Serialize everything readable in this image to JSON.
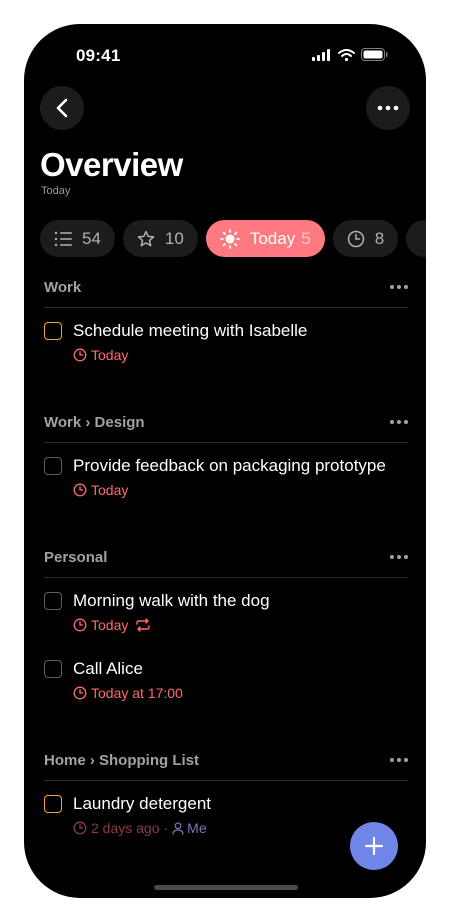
{
  "status": {
    "time": "09:41"
  },
  "header": {
    "title": "Overview",
    "subtitle": "Today"
  },
  "filters": [
    {
      "icon": "list-icon",
      "count": "54",
      "label": ""
    },
    {
      "icon": "star-icon",
      "count": "10",
      "label": ""
    },
    {
      "icon": "sun-icon",
      "count": "5",
      "label": "Today",
      "active": true
    },
    {
      "icon": "clock-icon",
      "count": "8",
      "label": ""
    }
  ],
  "sections": [
    {
      "name": "Work",
      "tasks": [
        {
          "title": "Schedule meeting with Isabelle",
          "due": "Today"
        }
      ]
    },
    {
      "name": "Work › Design",
      "tasks": [
        {
          "title": "Provide feedback on packaging prototype",
          "due": "Today"
        }
      ]
    },
    {
      "name": "Personal",
      "tasks": [
        {
          "title": "Morning walk with the dog",
          "due": "Today",
          "repeat": true
        },
        {
          "title": "Call Alice",
          "due": "Today at 17:00"
        }
      ]
    },
    {
      "name": "Home › Shopping List",
      "tasks": [
        {
          "title": "Laundry detergent",
          "due": "2 days ago",
          "sep": "·",
          "assignee": "Me"
        }
      ]
    }
  ],
  "colors": {
    "accent": "#ff7a80",
    "due": "#ff6b6f",
    "fab": "#6f86e8",
    "priority": "#f5a623"
  }
}
